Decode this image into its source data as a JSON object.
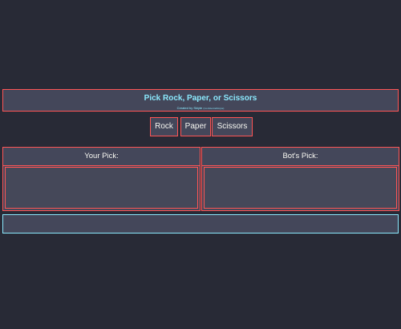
{
  "header": {
    "title": "Pick Rock, Paper, or Scissors",
    "credit": "Created by Skiyte",
    "credit_small": "(ConfidentialSkiyte)"
  },
  "controls": {
    "rock_label": "Rock",
    "paper_label": "Paper",
    "scissors_label": "Scissors"
  },
  "panels": {
    "player_title": "Your Pick:",
    "player_value": "",
    "bot_title": "Bot's Pick:",
    "bot_value": ""
  },
  "result": {
    "text": ""
  },
  "colors": {
    "background": "#282a36",
    "surface": "#44475a",
    "accent_red": "#ff5555",
    "accent_cyan": "#8be9fd",
    "text": "#f8f8f2"
  }
}
